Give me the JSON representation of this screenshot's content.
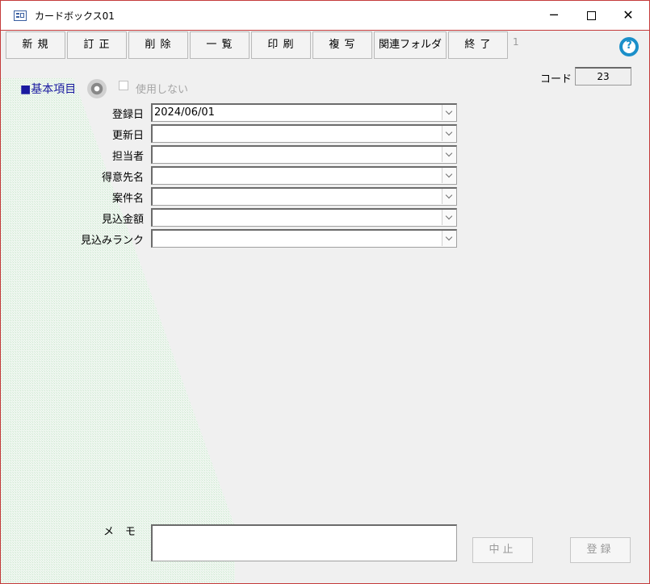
{
  "window": {
    "title": "カードボックス01"
  },
  "toolbar": [
    {
      "label": "新 規"
    },
    {
      "label": "訂 正"
    },
    {
      "label": "削 除"
    },
    {
      "label": "一 覧"
    },
    {
      "label": "印 刷"
    },
    {
      "label": "複 写"
    },
    {
      "label": "関連フォルダ"
    },
    {
      "label": "終 了"
    }
  ],
  "record_number": "1",
  "help": {
    "glyph": "?"
  },
  "code": {
    "label": "コード",
    "value": "23"
  },
  "section": {
    "title": "■基本項目",
    "unused_label": "使用しない"
  },
  "fields": [
    {
      "label": "登録日",
      "value": "2024/06/01"
    },
    {
      "label": "更新日",
      "value": ""
    },
    {
      "label": "担当者",
      "value": ""
    },
    {
      "label": "得意先名",
      "value": ""
    },
    {
      "label": "案件名",
      "value": ""
    },
    {
      "label": "見込金額",
      "value": ""
    },
    {
      "label": "見込みランク",
      "value": ""
    }
  ],
  "memo": {
    "label": "メモ",
    "value": ""
  },
  "actions": {
    "cancel": "中止",
    "register": "登録"
  },
  "icons": {
    "app": "app-form-icon",
    "gear": "gear-icon",
    "help": "help-icon",
    "dropdown": "chevron-down-icon"
  },
  "colors": {
    "accent_blue": "#1b8fc9",
    "section_title": "#1a1aa0",
    "window_border": "#c43a3a"
  }
}
